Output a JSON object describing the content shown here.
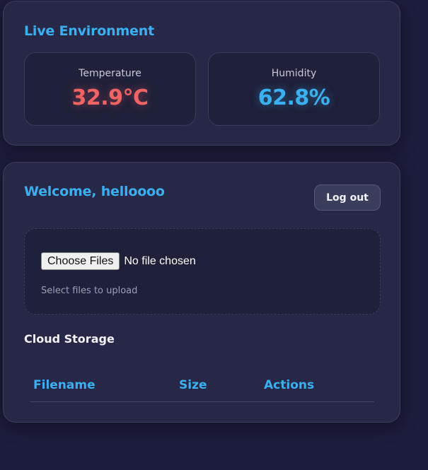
{
  "environment": {
    "title": "Live Environment",
    "temperature": {
      "label": "Temperature",
      "value": "32.9°C"
    },
    "humidity": {
      "label": "Humidity",
      "value": "62.8%"
    }
  },
  "dashboard": {
    "welcome": "Welcome, helloooo",
    "logout_label": "Log out"
  },
  "upload": {
    "choose_label": "Choose Files",
    "status": "No file chosen",
    "hint": "Select files to upload"
  },
  "storage": {
    "title": "Cloud Storage",
    "columns": [
      "Filename",
      "Size",
      "Actions"
    ]
  },
  "colors": {
    "accent": "#3ab0f0",
    "temperature": "#f26464",
    "background": "#1c1c3c",
    "card": "#272848"
  }
}
